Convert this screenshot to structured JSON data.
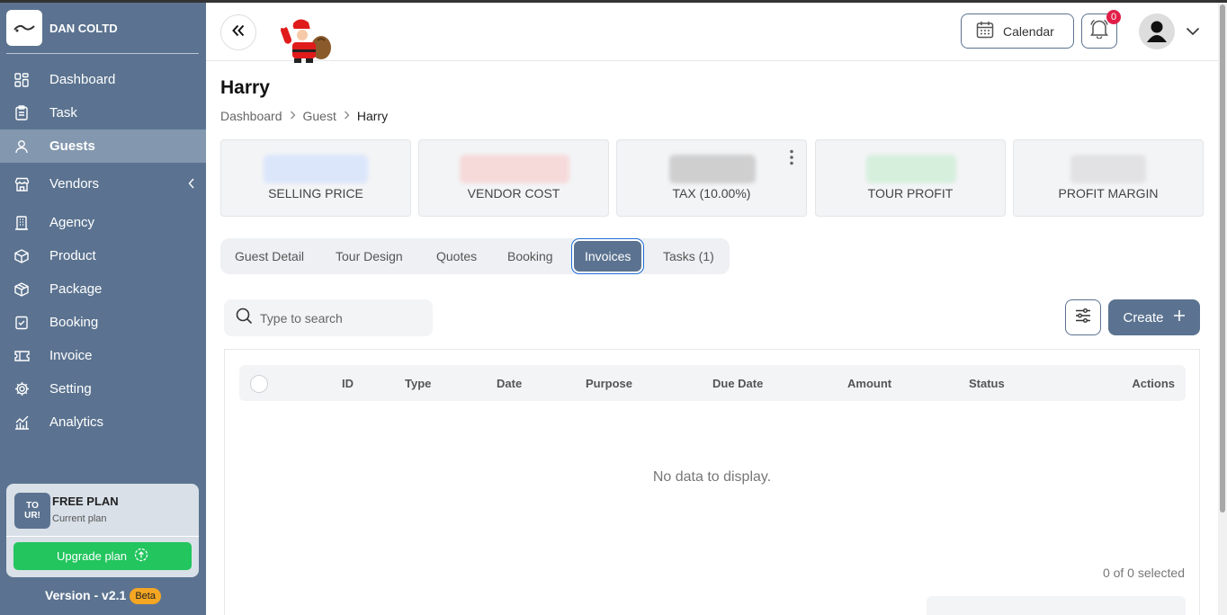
{
  "brand": {
    "name": "DAN COLTD",
    "logo_icon": "brand-logo-icon"
  },
  "sidebar": {
    "items": [
      {
        "label": "Dashboard",
        "icon": "dashboard-icon"
      },
      {
        "label": "Task",
        "icon": "clipboard-icon"
      },
      {
        "label": "Guests",
        "icon": "user-icon",
        "active": true
      },
      {
        "label": "Vendors",
        "icon": "store-icon"
      },
      {
        "label": "Agency",
        "icon": "building-icon"
      },
      {
        "label": "Product",
        "icon": "box-icon"
      },
      {
        "label": "Package",
        "icon": "package-icon"
      },
      {
        "label": "Booking",
        "icon": "booking-icon"
      },
      {
        "label": "Invoice",
        "icon": "ticket-icon"
      },
      {
        "label": "Setting",
        "icon": "gear-icon"
      },
      {
        "label": "Analytics",
        "icon": "analytics-icon"
      }
    ],
    "plan": {
      "logo_top": "TO",
      "logo_bottom": "UR!",
      "title": "FREE PLAN",
      "subtitle": "Current plan",
      "upgrade_label": "Upgrade plan"
    },
    "version": "Version - v2.1",
    "beta": "Beta"
  },
  "header": {
    "calendar_label": "Calendar",
    "notification_count": "0"
  },
  "page": {
    "title": "Harry",
    "breadcrumb": [
      "Dashboard",
      "Guest",
      "Harry"
    ]
  },
  "stats": [
    {
      "label": "SELLING PRICE",
      "blur_color": "#dbe6fb"
    },
    {
      "label": "VENDOR COST",
      "blur_color": "#f6dada"
    },
    {
      "label": "TAX (10.00%)",
      "blur_color": "#cfcfcf"
    },
    {
      "label": "TOUR PROFIT",
      "blur_color": "#d6efdd"
    },
    {
      "label": "PROFIT MARGIN",
      "blur_color": "#e2e2e4"
    }
  ],
  "tabs": [
    {
      "label": "Guest Detail"
    },
    {
      "label": "Tour Design"
    },
    {
      "label": "Quotes"
    },
    {
      "label": "Booking"
    },
    {
      "label": "Invoices",
      "active": true
    },
    {
      "label": "Tasks (1)"
    }
  ],
  "search": {
    "placeholder": "Type to search"
  },
  "actions": {
    "create_label": "Create"
  },
  "table": {
    "columns": [
      "ID",
      "Type",
      "Date",
      "Purpose",
      "Due Date",
      "Amount",
      "Status",
      "Actions"
    ],
    "empty_text": "No data to display.",
    "selected_text": "0 of 0 selected"
  },
  "colors": {
    "primary": "#5b7390",
    "sidebar_active": "#8397ae",
    "upgrade": "#22c55e",
    "badge": "#e11d48",
    "beta": "#f5a623"
  }
}
